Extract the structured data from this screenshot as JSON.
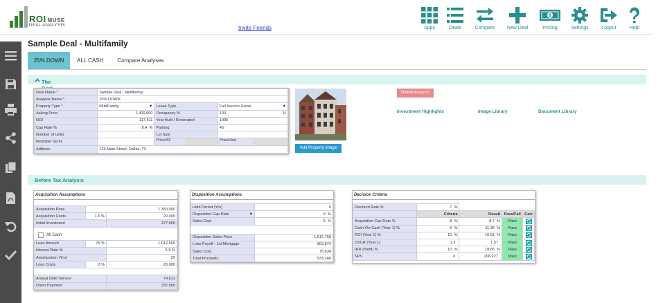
{
  "brand": {
    "name": "ROI",
    "name_suffix": "MUSE",
    "tagline": "DEAL ANALYSIS"
  },
  "header": {
    "invite": "Invite Friends"
  },
  "nav": [
    {
      "label": "Apps",
      "icon": "grid-icon"
    },
    {
      "label": "Deals",
      "icon": "list-icon"
    },
    {
      "label": "Compare",
      "icon": "arrows-icon"
    },
    {
      "label": "New Deal",
      "icon": "plus-icon"
    },
    {
      "label": "Pricing",
      "icon": "money-icon"
    },
    {
      "label": "Settings",
      "icon": "gear-icon"
    },
    {
      "label": "Logout",
      "icon": "logout-icon"
    },
    {
      "label": "Help",
      "icon": "help-icon"
    }
  ],
  "sidebar": [
    "menu-icon",
    "save-icon",
    "print-icon",
    "share-icon",
    "copy-icon",
    "pdf-icon",
    "undo-icon",
    "check-icon"
  ],
  "page": {
    "title": "Sample Deal - Multifamily"
  },
  "tabs": [
    "25% DOWN",
    "ALL CASH",
    "Compare Analyses"
  ],
  "sections": {
    "deal": "The Deal",
    "before_tax": "Before Tax Analysis"
  },
  "deal": {
    "deal_name_label": "Deal Name *",
    "deal_name": "Sample Deal - Multifamily",
    "analysis_name_label": "Analysis Name *",
    "analysis_name": "25% DOWN",
    "property_type_label": "Property Type *",
    "property_type": "MultiFamily",
    "lease_type_label": "Lease Type",
    "lease_type": "Full Service Gross",
    "asking_price_label": "Asking Price",
    "asking_price": "1,400,000",
    "occupancy_label": "Occupancy %",
    "occupancy": "100",
    "occupancy_unit": "%",
    "noi_label": "NOI",
    "noi": "117,511",
    "year_built_label": "Year Built / Renovated",
    "year_built": "1995",
    "cap_rate_label": "Cap Rate %",
    "cap_rate": "8.4",
    "cap_rate_unit": "%",
    "parking_label": "Parking",
    "parking": "45",
    "units_label": "Number of Units",
    "units": "",
    "lot_size_label": "Lot Size",
    "lot_size": "",
    "rentable_label": "Rentable Sq Ft.",
    "rentable": "",
    "price_sf_label": "Price/SF",
    "price_unit_label": "Price/Unit",
    "address_label": "Address",
    "address": "123 Main Street, Dallas, TX"
  },
  "media": {
    "add_image": "Add Property Image",
    "delete": "Delete Analysis",
    "highlights": "Investment Highlights",
    "image_library": "Image Library",
    "document_library": "Document Library"
  },
  "acquisition": {
    "title": "Acquisition Assumptions",
    "price_label": "Acquisition Price",
    "price": "1,350,000",
    "costs_label": "Acquisition Costs",
    "costs_pct": "1.5",
    "pct": "%",
    "costs": "20,000",
    "initial_label": "Initial Investment",
    "initial": "377,500",
    "all_cash": "All Cash",
    "loan_label": "Loan Amount",
    "loan_pct": "75",
    "loan": "1,012,500",
    "rate_label": "Interest Rate %",
    "rate": "5.5",
    "rate_unit": "%",
    "amort_label": "Amortization (Yrs)",
    "amort": "25",
    "loan_costs_label": "Loan Costs",
    "loan_costs_pct": "2",
    "loan_costs": "20,000",
    "debt_label": "Annual Debt Service",
    "debt": "74,612",
    "down_label": "Down Payment",
    "down": "337,500"
  },
  "disposition": {
    "title": "Disposition Assumptions",
    "hold_label": "Hold Period (Yrs)",
    "hold": "5",
    "cap_label": "Disposition Cap Rate",
    "cap": "9",
    "cap_unit": "%",
    "cost_label": "Sales Cost",
    "cost": "5",
    "cost_unit": "%",
    "price_label": "Disposition Sales Price",
    "price": "1,512,758",
    "payoff_label": "Loan Payoff - 1st Mortgage",
    "payoff": "903,874",
    "sales_cost_label": "Sales Cost",
    "sales_cost": "75,638",
    "proceeds_label": "Total Proceeds",
    "proceeds": "533,246"
  },
  "decision": {
    "title": "Decision Criteria",
    "discount_label": "Discount Rate %",
    "discount": "7",
    "discount_unit": "%",
    "col_criteria": "Criteria",
    "col_result": "Result",
    "col_pass": "Pass/Fail",
    "col_calc": "Calc",
    "rows": [
      {
        "label": "Acquisition Cap Rate %",
        "criteria": "8",
        "c_unit": "%",
        "result": "8.7",
        "r_unit": "%",
        "status": "Pass"
      },
      {
        "label": "Cash-On-Cash (Year 1) %",
        "criteria": "6",
        "c_unit": "%",
        "result": "11.36",
        "r_unit": "%",
        "status": "Pass"
      },
      {
        "label": "ROI (Year 1) %",
        "criteria": "10",
        "c_unit": "%",
        "result": "16.51",
        "r_unit": "%",
        "status": "Pass"
      },
      {
        "label": "DSCR (Year 1)",
        "criteria": "1.2",
        "c_unit": "",
        "result": "1.57",
        "r_unit": "",
        "status": "Pass"
      },
      {
        "label": "IRR (Yield) %",
        "criteria": "10",
        "c_unit": "%",
        "result": "18.65",
        "r_unit": "%",
        "status": "Pass"
      },
      {
        "label": "NPV",
        "criteria": "0",
        "c_unit": "",
        "result": "206,227",
        "r_unit": "",
        "status": "Pass"
      }
    ]
  },
  "colors": {
    "teal": "#2a8d8e",
    "tab_active": "#6cc3d0",
    "section_bg": "#d9f3f1",
    "label_bg": "#dfe3f3",
    "pass": "#8de8ad",
    "delete": "#e88a8a",
    "add_image": "#2c98c9"
  }
}
